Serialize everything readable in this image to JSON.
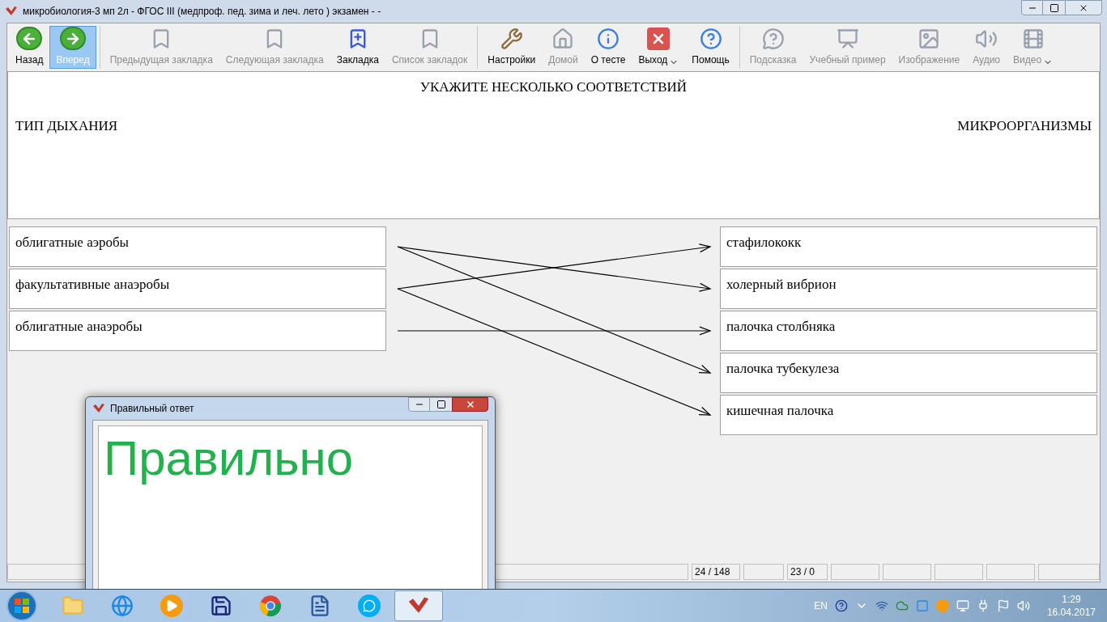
{
  "window": {
    "title": "микробиология-3 мп 2л - ФГОС III (медпроф. пед. зима и леч. лето ) экзамен -  -"
  },
  "toolbar": {
    "groups": [
      [
        {
          "label": "Назад",
          "kind": "back",
          "disabled": false,
          "selected": false,
          "has_menu": false
        },
        {
          "label": "Вперед",
          "kind": "forward",
          "disabled": false,
          "selected": true,
          "has_menu": false
        }
      ],
      [
        {
          "label": "Предыдущая закладка",
          "kind": "bookmark-prev",
          "disabled": true,
          "has_menu": false
        },
        {
          "label": "Следующая закладка",
          "kind": "bookmark-next",
          "disabled": true,
          "has_menu": false
        },
        {
          "label": "Закладка",
          "kind": "bookmark-add",
          "disabled": false,
          "has_menu": false
        },
        {
          "label": "Список закладок",
          "kind": "bookmark-list",
          "disabled": true,
          "has_menu": false
        }
      ],
      [
        {
          "label": "Настройки",
          "kind": "settings",
          "disabled": false,
          "has_menu": false
        },
        {
          "label": "Домой",
          "kind": "home",
          "disabled": true,
          "has_menu": false
        },
        {
          "label": "О тесте",
          "kind": "info",
          "disabled": false,
          "has_menu": false
        },
        {
          "label": "Выход",
          "kind": "exit",
          "disabled": false,
          "has_menu": true
        },
        {
          "label": "Помощь",
          "kind": "help",
          "disabled": false,
          "has_menu": false
        }
      ],
      [
        {
          "label": "Подсказка",
          "kind": "hint",
          "disabled": true,
          "has_menu": false
        },
        {
          "label": "Учебный пример",
          "kind": "example",
          "disabled": true,
          "has_menu": false
        },
        {
          "label": "Изображение",
          "kind": "image",
          "disabled": true,
          "has_menu": false
        },
        {
          "label": "Аудио",
          "kind": "audio",
          "disabled": true,
          "has_menu": false
        },
        {
          "label": "Видео",
          "kind": "video",
          "disabled": true,
          "has_menu": true
        }
      ]
    ]
  },
  "question": {
    "instruction": "УКАЖИТЕ НЕСКОЛЬКО СООТВЕТСТВИЙ",
    "left_heading": "ТИП ДЫХАНИЯ",
    "right_heading": "МИКРООРГАНИЗМЫ"
  },
  "matching": {
    "left": [
      {
        "text": "облигатные аэробы",
        "links": [
          false,
          true,
          false,
          true,
          false
        ]
      },
      {
        "text": "факультативные анаэробы",
        "links": [
          true,
          false,
          false,
          false,
          true
        ]
      },
      {
        "text": "облигатные анаэробы",
        "links": [
          false,
          false,
          true,
          false,
          false
        ]
      }
    ],
    "right": [
      "стафилококк",
      "холерный вибрион",
      "палочка столбняка",
      "палочка тубекулеза",
      "кишечная палочка"
    ]
  },
  "status_bar": {
    "cells": [
      "24 / 148",
      "23 / 0"
    ]
  },
  "dialog": {
    "title": "Правильный ответ",
    "result": "Правильно"
  },
  "taskbar": {
    "apps": [
      {
        "kind": "folder",
        "selected": false
      },
      {
        "kind": "browser-e",
        "selected": false
      },
      {
        "kind": "player",
        "selected": false
      },
      {
        "kind": "floppy",
        "selected": false
      },
      {
        "kind": "chrome",
        "selected": false
      },
      {
        "kind": "word",
        "selected": false
      },
      {
        "kind": "skype",
        "selected": false
      },
      {
        "kind": "test-app",
        "selected": true
      }
    ],
    "language": "EN",
    "time": "1:29",
    "date": "16.04.2017"
  }
}
